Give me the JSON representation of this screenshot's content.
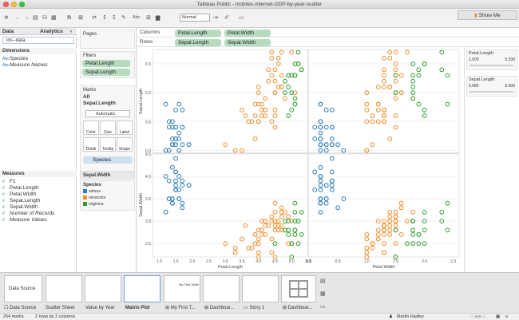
{
  "window": {
    "title": "Tableau Public - mobiles-Internet-GDP-by-year-scatter"
  },
  "toolbar": {
    "format_select": "Normal",
    "abc_label": "Abc",
    "show_me_label": "Show Me"
  },
  "left": {
    "tabs": [
      "Data",
      "Analytics"
    ],
    "datasource": "iris--data",
    "dimensions_header": "Dimensions",
    "dimensions": [
      {
        "icon": "Abc",
        "label": "Species",
        "italic": false
      },
      {
        "icon": "Abc",
        "label": "Measure Names",
        "italic": true
      }
    ],
    "measures_header": "Measures",
    "measures": [
      {
        "label": "F1",
        "italic": false
      },
      {
        "label": "Petal.Length",
        "italic": false
      },
      {
        "label": "Petal.Width",
        "italic": false
      },
      {
        "label": "Sepal.Length",
        "italic": false
      },
      {
        "label": "Sepal.Width",
        "italic": false
      },
      {
        "label": "Number of Records",
        "italic": true
      },
      {
        "label": "Measure Values",
        "italic": true
      }
    ]
  },
  "mid": {
    "pages_label": "Pages",
    "filters_label": "Filters",
    "filters": [
      "Petal.Length",
      "Sepal.Length"
    ],
    "marks_label": "Marks",
    "marks_all": "All",
    "marks_sub": "Sepal.Length",
    "mark_type": "Automatic",
    "mark_buttons": [
      "Color",
      "Size",
      "Label",
      "Detail",
      "Tooltip",
      "Shape"
    ],
    "color_pill": "Species",
    "legend_title_bar": "Sepal.Width",
    "legend_header": "Species",
    "legend": [
      {
        "label": "setosa",
        "color": "#2b7bba"
      },
      {
        "label": "versicolor",
        "color": "#f28e2b"
      },
      {
        "label": "virginica",
        "color": "#2ca02c"
      }
    ]
  },
  "shelves": {
    "columns_label": "Columns",
    "columns": [
      "Petal.Length",
      "Petal.Width"
    ],
    "rows_label": "Rows",
    "rows": [
      "Sepal.Length",
      "Sepal.Width"
    ]
  },
  "right": {
    "filters": [
      {
        "title": "Petal.Length",
        "lo": "1.000",
        "hi": "5.330"
      },
      {
        "title": "Sepal.Length",
        "lo": "5.080",
        "hi": "6.600"
      }
    ]
  },
  "chart_data": {
    "type": "scatter",
    "title": "",
    "ylabel_top": "Sepal.Length",
    "ylabel_bottom": "Sepal.Width",
    "xlabel_left": "Petal.Length",
    "xlabel_right": "Petal.Width",
    "x_left_ticks": [
      "1.0",
      "1.5",
      "2.0",
      "2.5",
      "3.0",
      "3.5",
      "4.0",
      "4.5",
      "5.0",
      "5.5"
    ],
    "x_right_ticks": [
      "0.0",
      "0.5",
      "1.0",
      "1.5",
      "2.0",
      "2.5"
    ],
    "y_top_ticks": [
      "5.0",
      "5.5",
      "6.0",
      "6.5"
    ],
    "y_bottom_ticks": [
      "2.5",
      "3.0",
      "3.5",
      "4.0",
      "4.5"
    ],
    "xlim_left": [
      0.8,
      5.5
    ],
    "xlim_right": [
      0.0,
      2.6
    ],
    "ylim_top": [
      4.95,
      6.75
    ],
    "ylim_bottom": [
      2.2,
      4.5
    ],
    "colors": {
      "setosa": "#2b7bba",
      "versicolor": "#f28e2b",
      "virginica": "#2ca02c"
    },
    "points": [
      {
        "species": "setosa",
        "pl": 1.4,
        "pw": 0.2,
        "sl": 5.1,
        "sw": 3.5
      },
      {
        "species": "setosa",
        "pl": 1.4,
        "pw": 0.2,
        "sl": 5.1,
        "sw": 3.4
      },
      {
        "species": "setosa",
        "pl": 1.5,
        "pw": 0.2,
        "sl": 5.4,
        "sw": 3.9
      },
      {
        "species": "setosa",
        "pl": 1.7,
        "pw": 0.4,
        "sl": 5.4,
        "sw": 3.9
      },
      {
        "species": "setosa",
        "pl": 1.5,
        "pw": 0.1,
        "sl": 5.4,
        "sw": 3.7
      },
      {
        "species": "setosa",
        "pl": 1.6,
        "pw": 0.2,
        "sl": 5.8,
        "sw": 4.0
      },
      {
        "species": "setosa",
        "pl": 1.5,
        "pw": 0.4,
        "sl": 5.7,
        "sw": 4.4
      },
      {
        "species": "setosa",
        "pl": 1.3,
        "pw": 0.4,
        "sl": 5.4,
        "sw": 3.9
      },
      {
        "species": "setosa",
        "pl": 1.4,
        "pw": 0.3,
        "sl": 5.1,
        "sw": 3.5
      },
      {
        "species": "setosa",
        "pl": 1.7,
        "pw": 0.3,
        "sl": 5.7,
        "sw": 3.8
      },
      {
        "species": "setosa",
        "pl": 1.5,
        "pw": 0.3,
        "sl": 5.1,
        "sw": 3.8
      },
      {
        "species": "setosa",
        "pl": 1.7,
        "pw": 0.2,
        "sl": 5.4,
        "sw": 3.4
      },
      {
        "species": "setosa",
        "pl": 1.5,
        "pw": 0.4,
        "sl": 5.1,
        "sw": 3.7
      },
      {
        "species": "setosa",
        "pl": 1.2,
        "pw": 0.2,
        "sl": 5.8,
        "sw": 4.0
      },
      {
        "species": "setosa",
        "pl": 1.9,
        "pw": 0.2,
        "sl": 5.1,
        "sw": 3.8
      },
      {
        "species": "setosa",
        "pl": 1.6,
        "pw": 0.2,
        "sl": 5.2,
        "sw": 3.5
      },
      {
        "species": "setosa",
        "pl": 1.4,
        "pw": 0.2,
        "sl": 5.2,
        "sw": 3.4
      },
      {
        "species": "setosa",
        "pl": 1.5,
        "pw": 0.4,
        "sl": 5.2,
        "sw": 4.1
      },
      {
        "species": "setosa",
        "pl": 1.4,
        "pw": 0.2,
        "sl": 5.5,
        "sw": 4.2
      },
      {
        "species": "setosa",
        "pl": 1.3,
        "pw": 0.2,
        "sl": 5.5,
        "sw": 3.5
      },
      {
        "species": "setosa",
        "pl": 1.6,
        "pw": 0.6,
        "sl": 5.0,
        "sw": 3.5
      },
      {
        "species": "setosa",
        "pl": 1.9,
        "pw": 0.4,
        "sl": 5.1,
        "sw": 3.8
      },
      {
        "species": "setosa",
        "pl": 1.6,
        "pw": 0.2,
        "sl": 5.3,
        "sw": 3.7
      },
      {
        "species": "setosa",
        "pl": 1.4,
        "pw": 0.3,
        "sl": 5.4,
        "sw": 3.4
      },
      {
        "species": "setosa",
        "pl": 1.2,
        "pw": 0.2,
        "sl": 5.0,
        "sw": 3.2
      },
      {
        "species": "setosa",
        "pl": 1.7,
        "pw": 0.5,
        "sl": 5.1,
        "sw": 3.3
      },
      {
        "species": "setosa",
        "pl": 1.3,
        "pw": 0.3,
        "sl": 5.0,
        "sw": 3.5
      },
      {
        "species": "setosa",
        "pl": 1.5,
        "pw": 0.1,
        "sl": 5.2,
        "sw": 4.1
      },
      {
        "species": "versicolor",
        "pl": 4.7,
        "pw": 1.4,
        "sl": 7.0,
        "sw": 3.2
      },
      {
        "species": "versicolor",
        "pl": 4.5,
        "pw": 1.5,
        "sl": 6.4,
        "sw": 3.2
      },
      {
        "species": "versicolor",
        "pl": 4.9,
        "pw": 1.5,
        "sl": 6.9,
        "sw": 3.1
      },
      {
        "species": "versicolor",
        "pl": 4.0,
        "pw": 1.3,
        "sl": 5.5,
        "sw": 2.3
      },
      {
        "species": "versicolor",
        "pl": 4.6,
        "pw": 1.5,
        "sl": 6.5,
        "sw": 2.8
      },
      {
        "species": "versicolor",
        "pl": 4.5,
        "pw": 1.3,
        "sl": 5.7,
        "sw": 2.8
      },
      {
        "species": "versicolor",
        "pl": 4.7,
        "pw": 1.6,
        "sl": 6.3,
        "sw": 3.3
      },
      {
        "species": "versicolor",
        "pl": 3.3,
        "pw": 1.0,
        "sl": 4.9,
        "sw": 2.4
      },
      {
        "species": "versicolor",
        "pl": 4.6,
        "pw": 1.3,
        "sl": 6.6,
        "sw": 2.9
      },
      {
        "species": "versicolor",
        "pl": 3.9,
        "pw": 1.4,
        "sl": 5.2,
        "sw": 2.7
      },
      {
        "species": "versicolor",
        "pl": 3.5,
        "pw": 1.0,
        "sl": 5.0,
        "sw": 2.0
      },
      {
        "species": "versicolor",
        "pl": 4.2,
        "pw": 1.5,
        "sl": 5.9,
        "sw": 3.0
      },
      {
        "species": "versicolor",
        "pl": 4.0,
        "pw": 1.0,
        "sl": 6.0,
        "sw": 2.2
      },
      {
        "species": "versicolor",
        "pl": 4.7,
        "pw": 1.4,
        "sl": 6.1,
        "sw": 2.9
      },
      {
        "species": "versicolor",
        "pl": 3.6,
        "pw": 1.3,
        "sl": 5.6,
        "sw": 2.9
      },
      {
        "species": "versicolor",
        "pl": 4.4,
        "pw": 1.4,
        "sl": 6.7,
        "sw": 3.1
      },
      {
        "species": "versicolor",
        "pl": 4.5,
        "pw": 1.5,
        "sl": 5.6,
        "sw": 3.0
      },
      {
        "species": "versicolor",
        "pl": 4.1,
        "pw": 1.0,
        "sl": 5.8,
        "sw": 2.7
      },
      {
        "species": "versicolor",
        "pl": 4.5,
        "pw": 1.5,
        "sl": 6.2,
        "sw": 2.2
      },
      {
        "species": "versicolor",
        "pl": 3.9,
        "pw": 1.1,
        "sl": 5.6,
        "sw": 2.5
      },
      {
        "species": "versicolor",
        "pl": 4.8,
        "pw": 1.8,
        "sl": 5.9,
        "sw": 3.2
      },
      {
        "species": "versicolor",
        "pl": 4.0,
        "pw": 1.3,
        "sl": 6.1,
        "sw": 2.8
      },
      {
        "species": "versicolor",
        "pl": 4.9,
        "pw": 1.5,
        "sl": 6.3,
        "sw": 2.5
      },
      {
        "species": "versicolor",
        "pl": 4.7,
        "pw": 1.2,
        "sl": 6.1,
        "sw": 2.8
      },
      {
        "species": "versicolor",
        "pl": 4.3,
        "pw": 1.3,
        "sl": 6.4,
        "sw": 2.9
      },
      {
        "species": "versicolor",
        "pl": 4.4,
        "pw": 1.4,
        "sl": 6.6,
        "sw": 3.0
      },
      {
        "species": "versicolor",
        "pl": 4.8,
        "pw": 1.4,
        "sl": 6.8,
        "sw": 2.8
      },
      {
        "species": "versicolor",
        "pl": 5.0,
        "pw": 1.7,
        "sl": 6.7,
        "sw": 3.0
      },
      {
        "species": "versicolor",
        "pl": 4.5,
        "pw": 1.5,
        "sl": 6.0,
        "sw": 2.9
      },
      {
        "species": "versicolor",
        "pl": 3.5,
        "pw": 1.0,
        "sl": 5.7,
        "sw": 2.6
      },
      {
        "species": "versicolor",
        "pl": 3.8,
        "pw": 1.1,
        "sl": 5.5,
        "sw": 2.4
      },
      {
        "species": "versicolor",
        "pl": 3.7,
        "pw": 1.0,
        "sl": 5.5,
        "sw": 2.4
      },
      {
        "species": "versicolor",
        "pl": 3.9,
        "pw": 1.2,
        "sl": 5.8,
        "sw": 2.7
      },
      {
        "species": "versicolor",
        "pl": 5.1,
        "pw": 1.6,
        "sl": 6.0,
        "sw": 2.7
      },
      {
        "species": "versicolor",
        "pl": 4.5,
        "pw": 1.5,
        "sl": 5.4,
        "sw": 3.0
      },
      {
        "species": "versicolor",
        "pl": 4.5,
        "pw": 1.6,
        "sl": 6.0,
        "sw": 3.4
      },
      {
        "species": "versicolor",
        "pl": 4.7,
        "pw": 1.5,
        "sl": 6.7,
        "sw": 3.1
      },
      {
        "species": "versicolor",
        "pl": 4.4,
        "pw": 1.3,
        "sl": 6.3,
        "sw": 2.3
      },
      {
        "species": "versicolor",
        "pl": 4.1,
        "pw": 1.3,
        "sl": 5.6,
        "sw": 3.0
      },
      {
        "species": "versicolor",
        "pl": 4.0,
        "pw": 1.3,
        "sl": 5.5,
        "sw": 2.5
      },
      {
        "species": "versicolor",
        "pl": 4.4,
        "pw": 1.2,
        "sl": 5.5,
        "sw": 2.6
      },
      {
        "species": "versicolor",
        "pl": 4.6,
        "pw": 1.4,
        "sl": 6.1,
        "sw": 3.0
      },
      {
        "species": "versicolor",
        "pl": 4.0,
        "pw": 1.2,
        "sl": 5.8,
        "sw": 2.6
      },
      {
        "species": "versicolor",
        "pl": 3.3,
        "pw": 1.0,
        "sl": 5.0,
        "sw": 2.3
      },
      {
        "species": "versicolor",
        "pl": 4.2,
        "pw": 1.3,
        "sl": 5.6,
        "sw": 2.7
      },
      {
        "species": "versicolor",
        "pl": 4.2,
        "pw": 1.2,
        "sl": 5.7,
        "sw": 3.0
      },
      {
        "species": "versicolor",
        "pl": 4.2,
        "pw": 1.3,
        "sl": 5.7,
        "sw": 2.9
      },
      {
        "species": "versicolor",
        "pl": 4.3,
        "pw": 1.3,
        "sl": 6.2,
        "sw": 2.9
      },
      {
        "species": "versicolor",
        "pl": 3.0,
        "pw": 1.1,
        "sl": 5.1,
        "sw": 2.5
      },
      {
        "species": "versicolor",
        "pl": 4.1,
        "pw": 1.3,
        "sl": 5.7,
        "sw": 2.8
      },
      {
        "species": "virginica",
        "pl": 5.1,
        "pw": 1.9,
        "sl": 5.8,
        "sw": 2.7
      },
      {
        "species": "virginica",
        "pl": 5.1,
        "pw": 2.0,
        "sl": 6.5,
        "sw": 3.2
      },
      {
        "species": "virginica",
        "pl": 5.3,
        "pw": 1.9,
        "sl": 6.4,
        "sw": 2.7
      },
      {
        "species": "virginica",
        "pl": 5.0,
        "pw": 2.0,
        "sl": 5.7,
        "sw": 2.5
      },
      {
        "species": "virginica",
        "pl": 5.1,
        "pw": 2.4,
        "sl": 5.8,
        "sw": 2.8
      },
      {
        "species": "virginica",
        "pl": 5.3,
        "pw": 2.3,
        "sl": 6.4,
        "sw": 3.2
      },
      {
        "species": "virginica",
        "pl": 5.0,
        "pw": 1.5,
        "sl": 6.0,
        "sw": 2.2
      },
      {
        "species": "virginica",
        "pl": 4.9,
        "pw": 2.0,
        "sl": 5.6,
        "sw": 2.8
      },
      {
        "species": "virginica",
        "pl": 4.9,
        "pw": 1.8,
        "sl": 6.3,
        "sw": 2.7
      },
      {
        "species": "virginica",
        "pl": 4.8,
        "pw": 1.8,
        "sl": 6.2,
        "sw": 2.8
      },
      {
        "species": "virginica",
        "pl": 4.9,
        "pw": 1.8,
        "sl": 6.1,
        "sw": 3.0
      },
      {
        "species": "virginica",
        "pl": 5.1,
        "pw": 1.5,
        "sl": 6.3,
        "sw": 2.8
      },
      {
        "species": "virginica",
        "pl": 5.0,
        "pw": 1.9,
        "sl": 6.3,
        "sw": 2.5
      },
      {
        "species": "virginica",
        "pl": 5.2,
        "pw": 2.3,
        "sl": 6.7,
        "sw": 3.0
      },
      {
        "species": "virginica",
        "pl": 5.2,
        "pw": 2.0,
        "sl": 6.5,
        "sw": 3.0
      },
      {
        "species": "virginica",
        "pl": 5.1,
        "pw": 1.8,
        "sl": 5.9,
        "sw": 3.0
      },
      {
        "species": "virginica",
        "pl": 4.5,
        "pw": 1.7,
        "sl": 4.9,
        "sw": 2.5
      },
      {
        "species": "virginica",
        "pl": 4.8,
        "pw": 1.8,
        "sl": 6.0,
        "sw": 3.0
      },
      {
        "species": "virginica",
        "pl": 5.1,
        "pw": 2.4,
        "sl": 6.3,
        "sw": 3.4
      },
      {
        "species": "virginica",
        "pl": 5.2,
        "pw": 1.8,
        "sl": 6.5,
        "sw": 2.5
      }
    ]
  },
  "bottom": {
    "tabs": [
      {
        "label": "Data Source",
        "icon": "☐"
      },
      {
        "label": "Scatter Sheet",
        "icon": ""
      },
      {
        "label": "Value by Year",
        "icon": ""
      },
      {
        "label": "Matrix Plot",
        "icon": ""
      },
      {
        "label": "My First T...",
        "icon": "⊞"
      },
      {
        "label": "Dashboar...",
        "icon": "⊞"
      },
      {
        "label": "Story 1",
        "icon": "▭"
      },
      {
        "label": "Dashboar...",
        "icon": "⊞"
      }
    ],
    "thumb_text": "Data Source",
    "thumb_dash_title": "My First Table"
  },
  "status": {
    "marks": "254 marks",
    "rows_cols": "2 rows by 2 columns",
    "user": "Martin Hadley"
  }
}
